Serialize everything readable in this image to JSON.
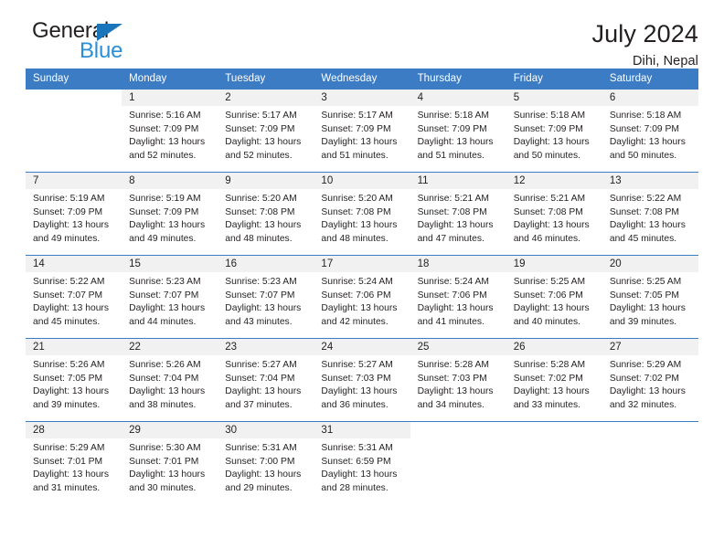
{
  "brand": {
    "name_top": "General",
    "name_bottom": "Blue",
    "triangle_color": "#1b75bb",
    "bottom_color": "#2a8fd4"
  },
  "header": {
    "title": "July 2024",
    "location": "Dihi, Nepal",
    "accent_color": "#3b7cc4",
    "daynum_band_color": "#f1f1f1"
  },
  "calendar": {
    "weekday_headers": [
      "Sunday",
      "Monday",
      "Tuesday",
      "Wednesday",
      "Thursday",
      "Friday",
      "Saturday"
    ],
    "weeks": [
      [
        {
          "day": "",
          "sunrise": "",
          "sunset": "",
          "daylight": "",
          "empty": true
        },
        {
          "day": "1",
          "sunrise": "Sunrise: 5:16 AM",
          "sunset": "Sunset: 7:09 PM",
          "daylight": "Daylight: 13 hours and 52 minutes."
        },
        {
          "day": "2",
          "sunrise": "Sunrise: 5:17 AM",
          "sunset": "Sunset: 7:09 PM",
          "daylight": "Daylight: 13 hours and 52 minutes."
        },
        {
          "day": "3",
          "sunrise": "Sunrise: 5:17 AM",
          "sunset": "Sunset: 7:09 PM",
          "daylight": "Daylight: 13 hours and 51 minutes."
        },
        {
          "day": "4",
          "sunrise": "Sunrise: 5:18 AM",
          "sunset": "Sunset: 7:09 PM",
          "daylight": "Daylight: 13 hours and 51 minutes."
        },
        {
          "day": "5",
          "sunrise": "Sunrise: 5:18 AM",
          "sunset": "Sunset: 7:09 PM",
          "daylight": "Daylight: 13 hours and 50 minutes."
        },
        {
          "day": "6",
          "sunrise": "Sunrise: 5:18 AM",
          "sunset": "Sunset: 7:09 PM",
          "daylight": "Daylight: 13 hours and 50 minutes."
        }
      ],
      [
        {
          "day": "7",
          "sunrise": "Sunrise: 5:19 AM",
          "sunset": "Sunset: 7:09 PM",
          "daylight": "Daylight: 13 hours and 49 minutes."
        },
        {
          "day": "8",
          "sunrise": "Sunrise: 5:19 AM",
          "sunset": "Sunset: 7:09 PM",
          "daylight": "Daylight: 13 hours and 49 minutes."
        },
        {
          "day": "9",
          "sunrise": "Sunrise: 5:20 AM",
          "sunset": "Sunset: 7:08 PM",
          "daylight": "Daylight: 13 hours and 48 minutes."
        },
        {
          "day": "10",
          "sunrise": "Sunrise: 5:20 AM",
          "sunset": "Sunset: 7:08 PM",
          "daylight": "Daylight: 13 hours and 48 minutes."
        },
        {
          "day": "11",
          "sunrise": "Sunrise: 5:21 AM",
          "sunset": "Sunset: 7:08 PM",
          "daylight": "Daylight: 13 hours and 47 minutes."
        },
        {
          "day": "12",
          "sunrise": "Sunrise: 5:21 AM",
          "sunset": "Sunset: 7:08 PM",
          "daylight": "Daylight: 13 hours and 46 minutes."
        },
        {
          "day": "13",
          "sunrise": "Sunrise: 5:22 AM",
          "sunset": "Sunset: 7:08 PM",
          "daylight": "Daylight: 13 hours and 45 minutes."
        }
      ],
      [
        {
          "day": "14",
          "sunrise": "Sunrise: 5:22 AM",
          "sunset": "Sunset: 7:07 PM",
          "daylight": "Daylight: 13 hours and 45 minutes."
        },
        {
          "day": "15",
          "sunrise": "Sunrise: 5:23 AM",
          "sunset": "Sunset: 7:07 PM",
          "daylight": "Daylight: 13 hours and 44 minutes."
        },
        {
          "day": "16",
          "sunrise": "Sunrise: 5:23 AM",
          "sunset": "Sunset: 7:07 PM",
          "daylight": "Daylight: 13 hours and 43 minutes."
        },
        {
          "day": "17",
          "sunrise": "Sunrise: 5:24 AM",
          "sunset": "Sunset: 7:06 PM",
          "daylight": "Daylight: 13 hours and 42 minutes."
        },
        {
          "day": "18",
          "sunrise": "Sunrise: 5:24 AM",
          "sunset": "Sunset: 7:06 PM",
          "daylight": "Daylight: 13 hours and 41 minutes."
        },
        {
          "day": "19",
          "sunrise": "Sunrise: 5:25 AM",
          "sunset": "Sunset: 7:06 PM",
          "daylight": "Daylight: 13 hours and 40 minutes."
        },
        {
          "day": "20",
          "sunrise": "Sunrise: 5:25 AM",
          "sunset": "Sunset: 7:05 PM",
          "daylight": "Daylight: 13 hours and 39 minutes."
        }
      ],
      [
        {
          "day": "21",
          "sunrise": "Sunrise: 5:26 AM",
          "sunset": "Sunset: 7:05 PM",
          "daylight": "Daylight: 13 hours and 39 minutes."
        },
        {
          "day": "22",
          "sunrise": "Sunrise: 5:26 AM",
          "sunset": "Sunset: 7:04 PM",
          "daylight": "Daylight: 13 hours and 38 minutes."
        },
        {
          "day": "23",
          "sunrise": "Sunrise: 5:27 AM",
          "sunset": "Sunset: 7:04 PM",
          "daylight": "Daylight: 13 hours and 37 minutes."
        },
        {
          "day": "24",
          "sunrise": "Sunrise: 5:27 AM",
          "sunset": "Sunset: 7:03 PM",
          "daylight": "Daylight: 13 hours and 36 minutes."
        },
        {
          "day": "25",
          "sunrise": "Sunrise: 5:28 AM",
          "sunset": "Sunset: 7:03 PM",
          "daylight": "Daylight: 13 hours and 34 minutes."
        },
        {
          "day": "26",
          "sunrise": "Sunrise: 5:28 AM",
          "sunset": "Sunset: 7:02 PM",
          "daylight": "Daylight: 13 hours and 33 minutes."
        },
        {
          "day": "27",
          "sunrise": "Sunrise: 5:29 AM",
          "sunset": "Sunset: 7:02 PM",
          "daylight": "Daylight: 13 hours and 32 minutes."
        }
      ],
      [
        {
          "day": "28",
          "sunrise": "Sunrise: 5:29 AM",
          "sunset": "Sunset: 7:01 PM",
          "daylight": "Daylight: 13 hours and 31 minutes."
        },
        {
          "day": "29",
          "sunrise": "Sunrise: 5:30 AM",
          "sunset": "Sunset: 7:01 PM",
          "daylight": "Daylight: 13 hours and 30 minutes."
        },
        {
          "day": "30",
          "sunrise": "Sunrise: 5:31 AM",
          "sunset": "Sunset: 7:00 PM",
          "daylight": "Daylight: 13 hours and 29 minutes."
        },
        {
          "day": "31",
          "sunrise": "Sunrise: 5:31 AM",
          "sunset": "Sunset: 6:59 PM",
          "daylight": "Daylight: 13 hours and 28 minutes."
        },
        {
          "day": "",
          "sunrise": "",
          "sunset": "",
          "daylight": "",
          "empty": true
        },
        {
          "day": "",
          "sunrise": "",
          "sunset": "",
          "daylight": "",
          "empty": true
        },
        {
          "day": "",
          "sunrise": "",
          "sunset": "",
          "daylight": "",
          "empty": true
        }
      ]
    ]
  }
}
